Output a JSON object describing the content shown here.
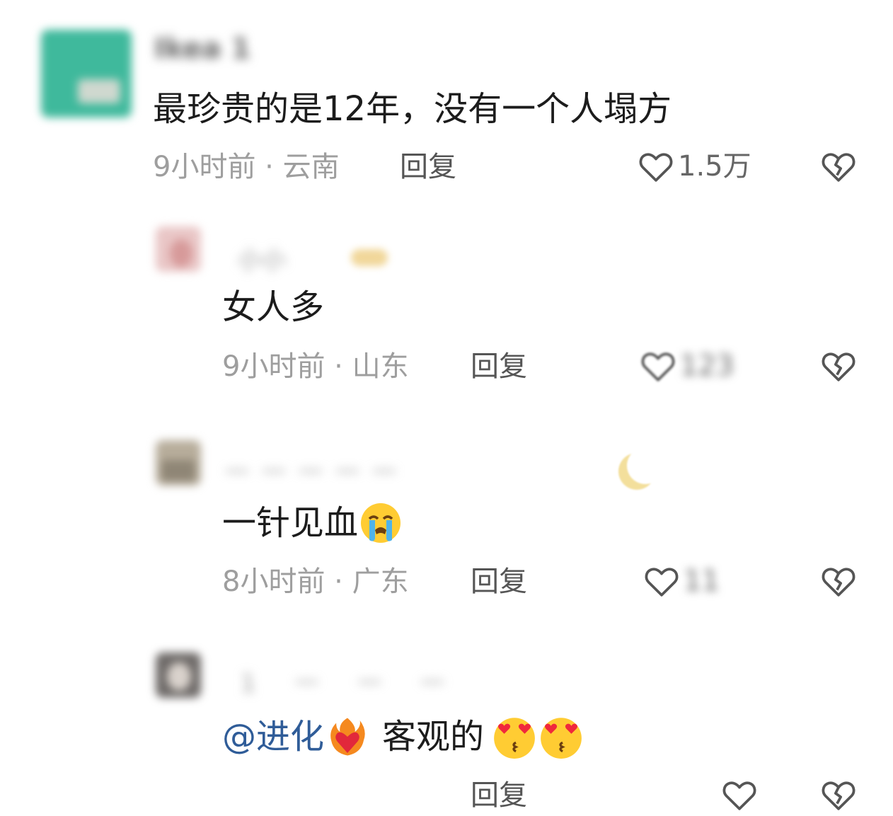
{
  "comments": [
    {
      "username": "Ikea 1",
      "text": "最珍贵的是12年，没有一个人塌方",
      "time_location": "9小时前 · 云南",
      "reply_label": "回复",
      "likes": "1.5万"
    },
    {
      "username": "小小",
      "text": "女人多",
      "time_location": "9小时前 · 山东",
      "reply_label": "回复",
      "likes": "123"
    },
    {
      "username": "一一一一一",
      "text": "一针见血",
      "time_location": "8小时前 · 广东",
      "reply_label": "回复",
      "likes": "11"
    },
    {
      "username": "1 一 一 一",
      "mention": "@进化",
      "text": "客观的",
      "reply_label": "回复"
    }
  ],
  "icons": {
    "like": "heart-outline-icon",
    "dislike": "broken-heart-icon",
    "crying": "loudly-crying-face-emoji",
    "heart_fire": "heart-on-fire-emoji",
    "kissing": "kissing-heart-eyes-emoji"
  },
  "colors": {
    "mention": "#2f5c98",
    "meta": "#9e9e9e",
    "text": "#1c1c1c"
  }
}
